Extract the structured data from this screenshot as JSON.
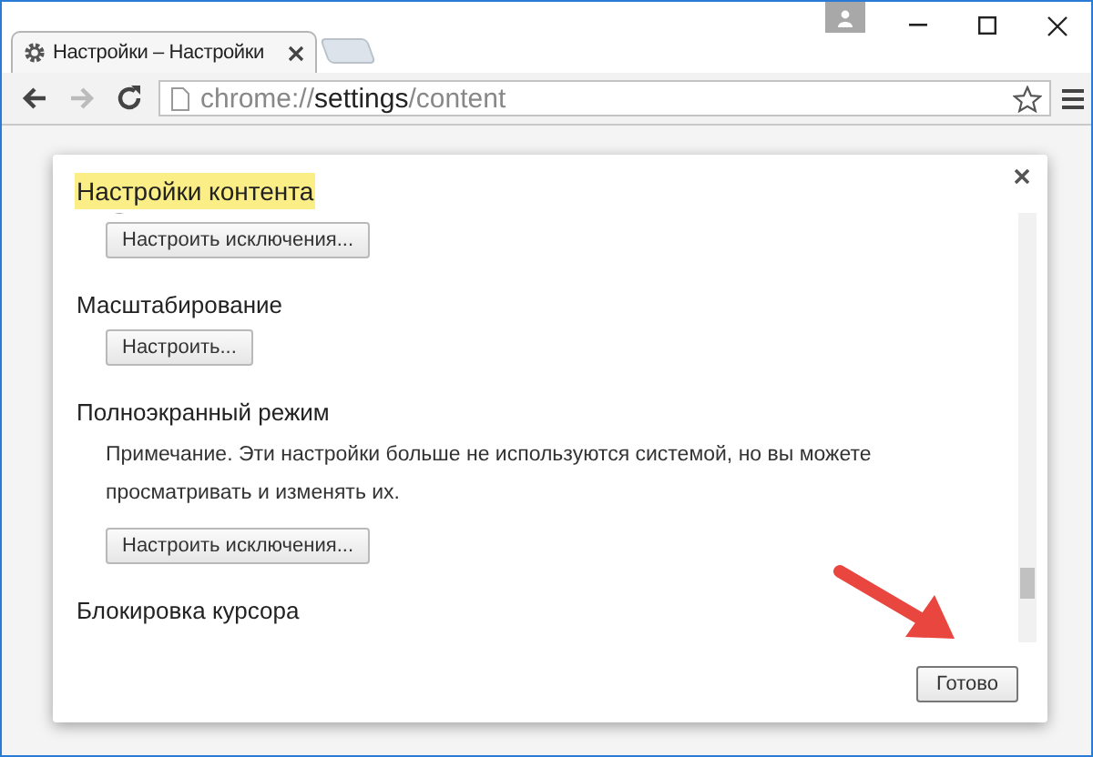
{
  "browser": {
    "tab": {
      "title": "Настройки – Настройки"
    },
    "address": {
      "scheme": "chrome://",
      "host": "settings",
      "path": "/content"
    }
  },
  "dialog": {
    "title": "Настройки контента",
    "sections": [
      {
        "kind": "radio-tail",
        "button": "Настроить исключения..."
      },
      {
        "kind": "section",
        "heading": "Масштабирование",
        "button": "Настроить..."
      },
      {
        "kind": "section",
        "heading": "Полноэкранный режим",
        "note": "Примечание. Эти настройки больше не используются системой, но вы можете просматривать и изменять их.",
        "button": "Настроить исключения..."
      },
      {
        "kind": "heading",
        "heading": "Блокировка курсора"
      }
    ],
    "done_button": "Готово"
  }
}
